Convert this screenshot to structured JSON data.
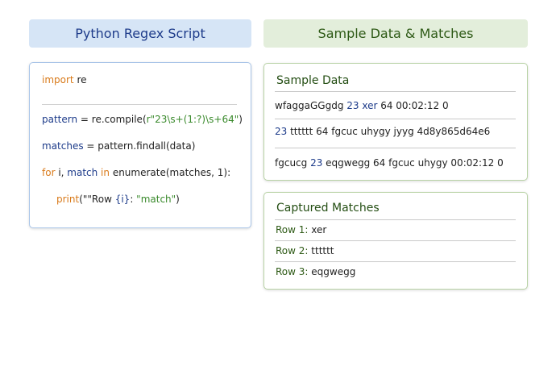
{
  "headers": {
    "script": "Python Regex Script",
    "data": "Sample Data & Matches"
  },
  "code": {
    "line1": {
      "kw": "import",
      "rest": " re"
    },
    "line2": {
      "var": "pattern",
      "mid": " = re.compile(",
      "str": "r\"23\\s+(1:?)\\s+64\"",
      "end": ")"
    },
    "line3": {
      "var": "matches",
      "rest": " = pattern.findall(data)"
    },
    "line4": {
      "kw1": "for",
      "v1": " i, ",
      "var": "match",
      "kw2": " in",
      "rest": " enumerate(matches, 1):"
    },
    "line5": {
      "fn": "print",
      "open": "(\"",
      "fmt": "\"Row ",
      "i": "{i}",
      "colon": ": ",
      "m": "\"match\"",
      "close": ")"
    }
  },
  "sample": {
    "title": "Sample Data",
    "row1": {
      "a": "wfaggaGGgdg  ",
      "hl": "23 xer",
      "b": "  64  00:02:12  0"
    },
    "row2": {
      "hl": "23",
      "b": " tttttt  64  fgcuc  uhygy  jyyg  4d8y865d64e6"
    },
    "row3": {
      "a": "fgcucg  ",
      "hl": "23",
      "b": "  eqgwegg  64  fgcuc  uhygy   00:02:12  0"
    }
  },
  "matches": {
    "title": "Captured Matches",
    "rows": [
      {
        "label": "Row 1:",
        "value": "xer"
      },
      {
        "label": "Row 2:",
        "value": "tttttt"
      },
      {
        "label": "Row 3:",
        "value": "eqgwegg"
      }
    ]
  }
}
